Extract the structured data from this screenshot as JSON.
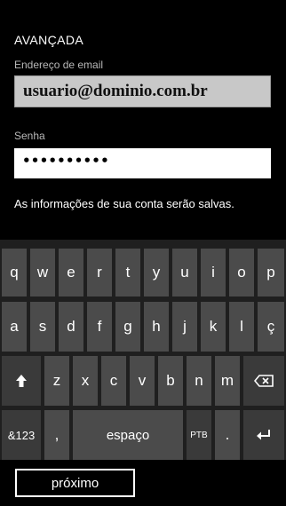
{
  "form": {
    "section_title": "AVANÇADA",
    "email_label": "Endereço de email",
    "email_value": "usuario@dominio.com.br",
    "password_label": "Senha",
    "password_value": "••••••••••",
    "info_text": "As informações de sua conta serão salvas."
  },
  "keyboard": {
    "row1": [
      "q",
      "w",
      "e",
      "r",
      "t",
      "y",
      "u",
      "i",
      "o",
      "p"
    ],
    "row2": [
      "a",
      "s",
      "d",
      "f",
      "g",
      "h",
      "j",
      "k",
      "l",
      "ç"
    ],
    "row3": [
      "z",
      "x",
      "c",
      "v",
      "b",
      "n",
      "m"
    ],
    "numbers_key": "&123",
    "comma_key": ",",
    "space_key": "espaço",
    "language_key": "PTB",
    "period_key": ".",
    "shift_icon": "shift-arrow-icon",
    "backspace_icon": "backspace-icon",
    "enter_icon": "enter-icon"
  },
  "app_bar": {
    "next_label": "próximo"
  },
  "colors": {
    "background": "#000000",
    "keyboard_background": "#1f1f1f",
    "key": "#4b4b4b",
    "email_field": "#c8c8c8"
  }
}
